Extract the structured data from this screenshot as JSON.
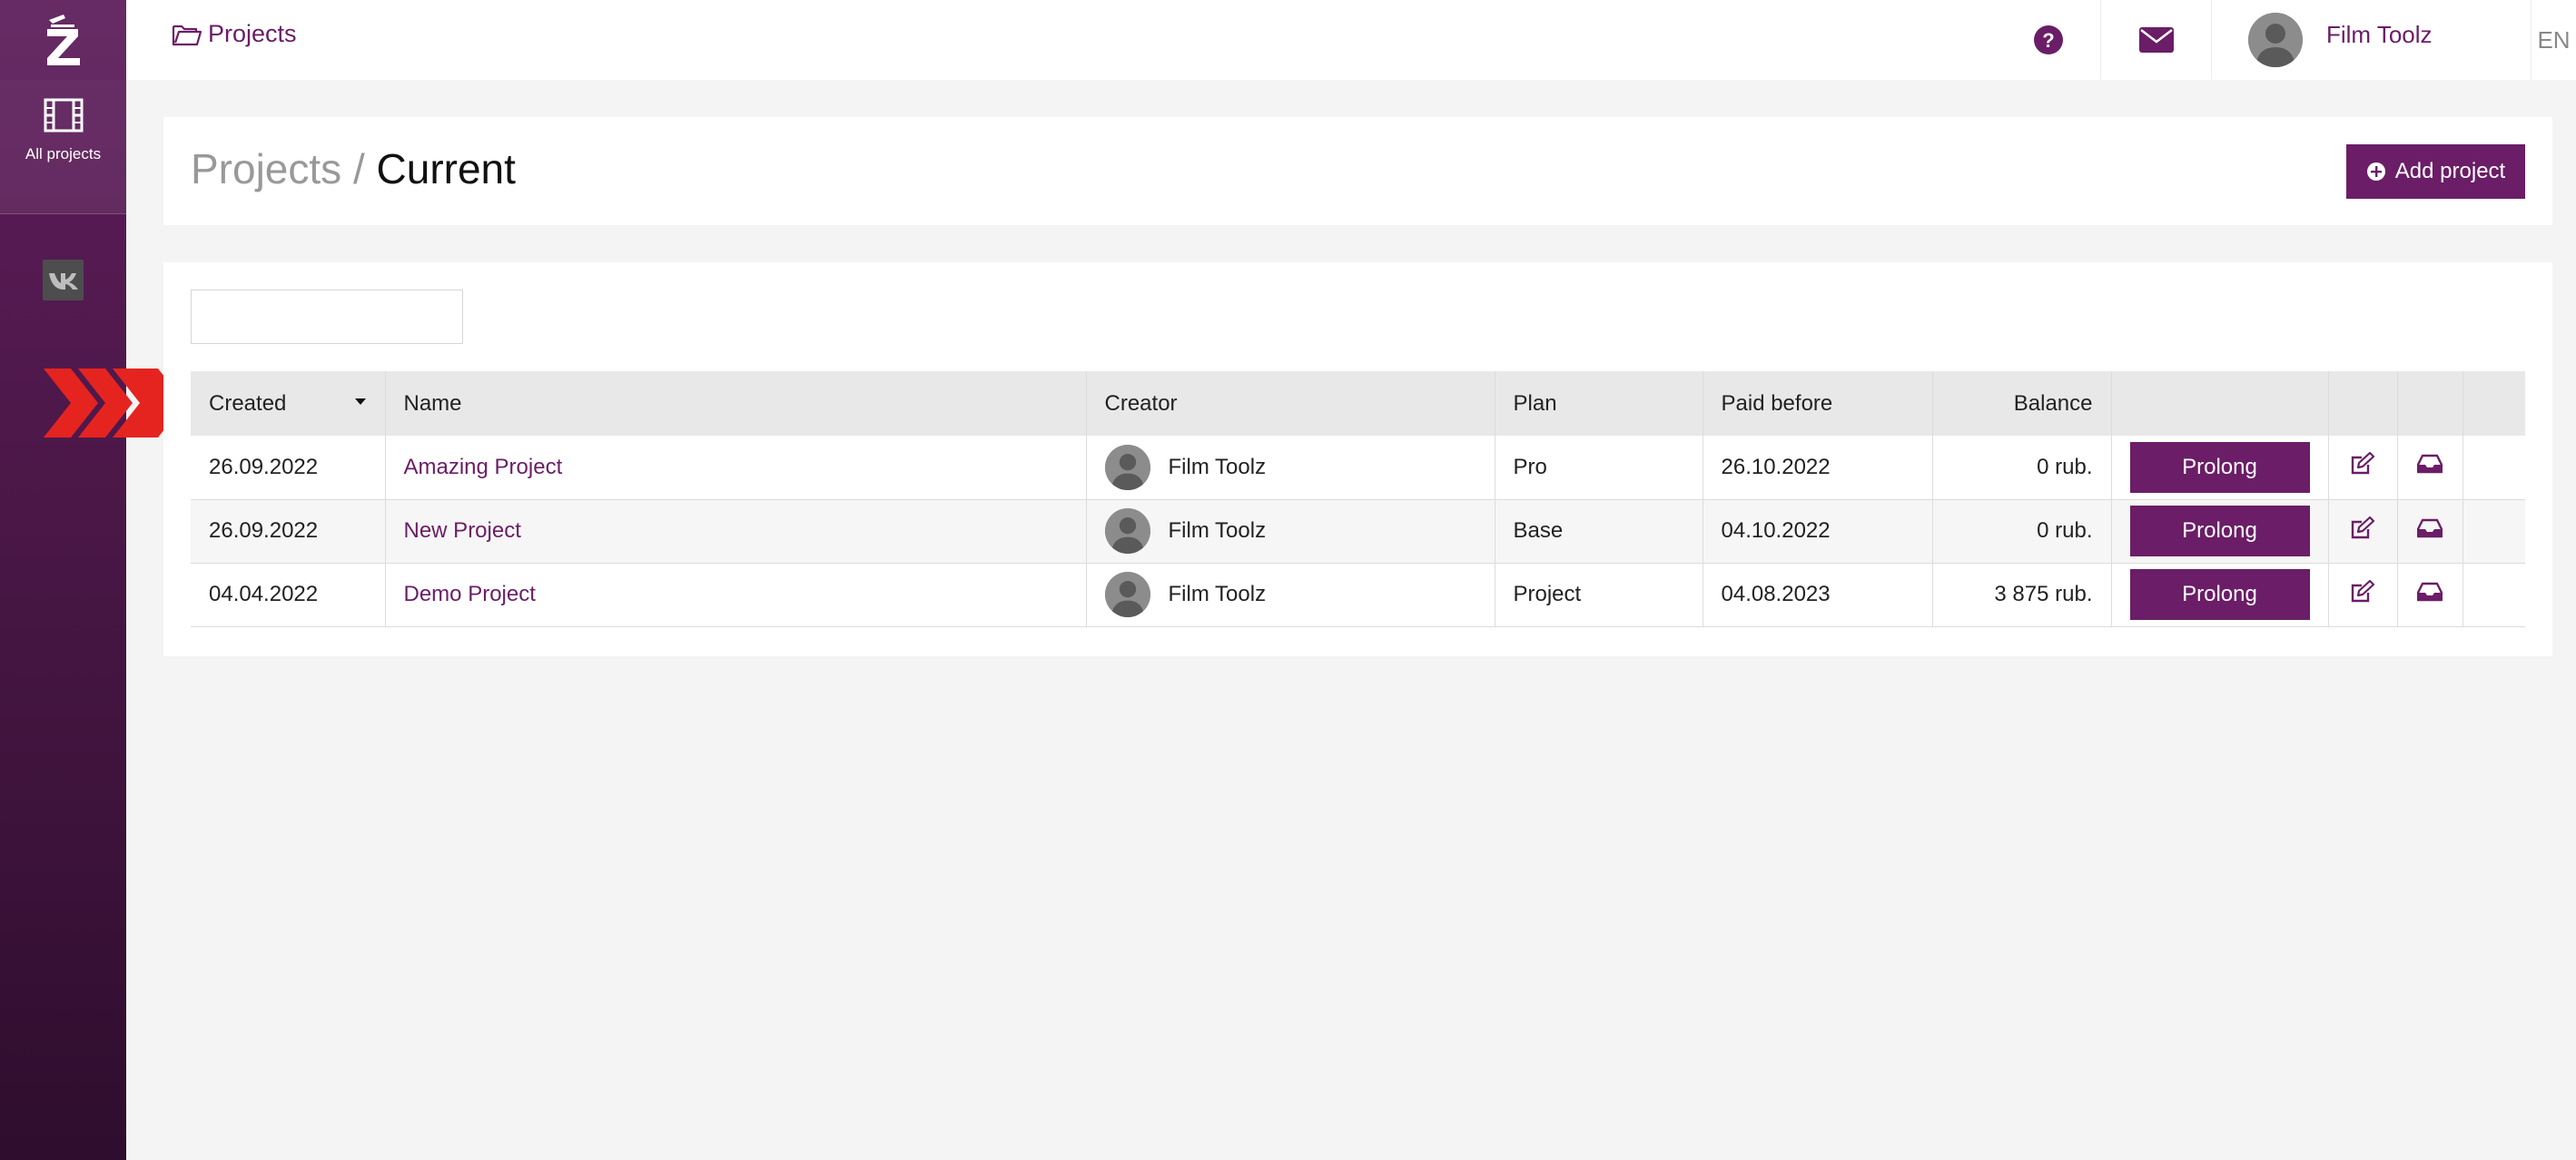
{
  "sidebar": {
    "nav_label": "All projects"
  },
  "topbar": {
    "breadcrumb": "Projects",
    "user_name": "Film Toolz",
    "language": "EN"
  },
  "header": {
    "title_muted": "Projects /",
    "title_current": "Current",
    "add_button": "Add project"
  },
  "search": {
    "value": "",
    "placeholder": ""
  },
  "table": {
    "columns": [
      "Created",
      "Name",
      "Creator",
      "Plan",
      "Paid before",
      "Balance"
    ],
    "rows": [
      {
        "created": "26.09.2022",
        "name": "Amazing Project",
        "creator": "Film Toolz",
        "plan": "Pro",
        "paid_before": "26.10.2022",
        "balance": "0 rub.",
        "action": "Prolong"
      },
      {
        "created": "26.09.2022",
        "name": "New Project",
        "creator": "Film Toolz",
        "plan": "Base",
        "paid_before": "04.10.2022",
        "balance": "0 rub.",
        "action": "Prolong"
      },
      {
        "created": "04.04.2022",
        "name": "Demo Project",
        "creator": "Film Toolz",
        "plan": "Project",
        "paid_before": "04.08.2023",
        "balance": "3 875 rub.",
        "action": "Prolong"
      }
    ]
  },
  "colors": {
    "brand": "#6b1d67",
    "sidebar_top": "#5e1d5c",
    "arrow": "#e52420"
  },
  "icons": [
    "logo-icon",
    "film-icon",
    "vk-icon",
    "chevron-arrows-icon",
    "folder-open-icon",
    "help-icon",
    "mail-icon",
    "plus-circle-icon",
    "search-icon",
    "sort-caret-icon",
    "edit-icon",
    "inbox-icon"
  ]
}
